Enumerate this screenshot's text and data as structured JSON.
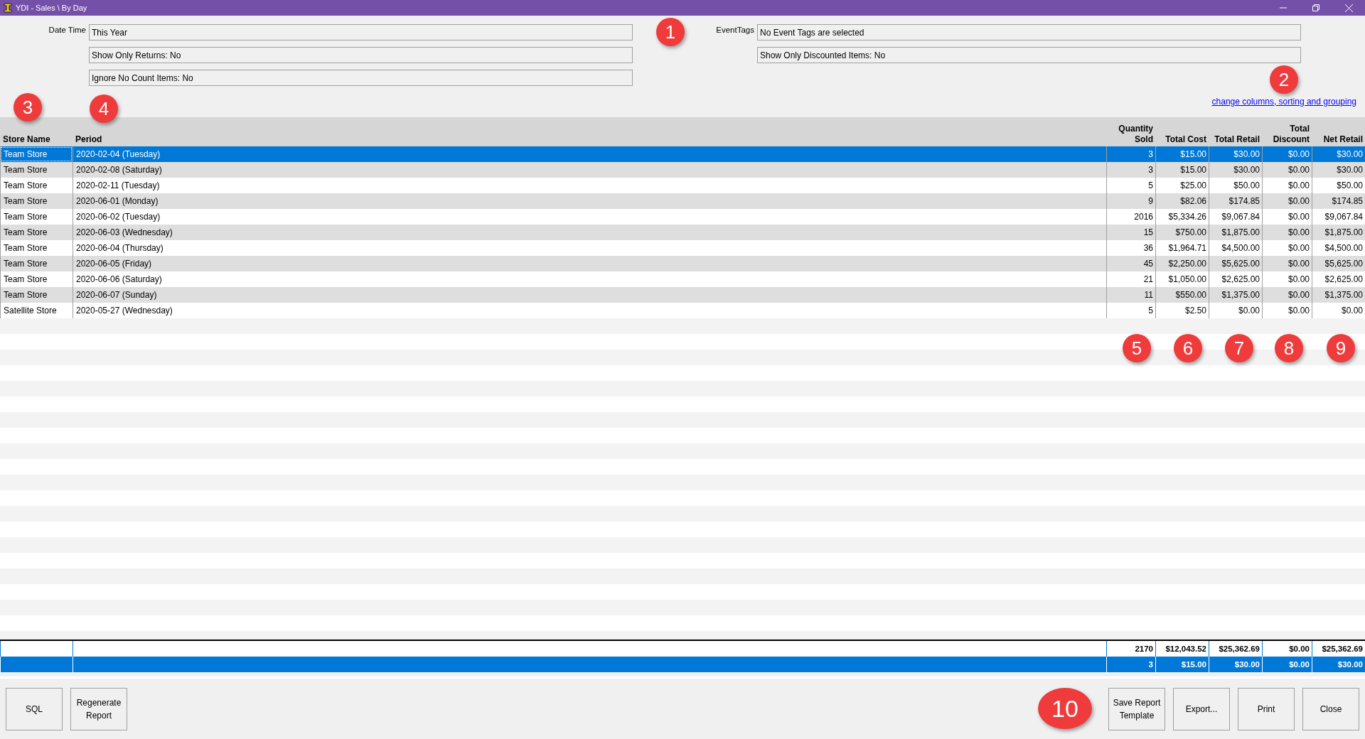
{
  "window": {
    "title": "YDI - Sales \\ By Day"
  },
  "filters_left": [
    {
      "label": "Date Time",
      "value": "This Year"
    },
    {
      "value": "Show Only Returns: No"
    },
    {
      "value": "Ignore No Count Items: No"
    }
  ],
  "filters_right": [
    {
      "label": "EventTags",
      "value": "No Event Tags are selected"
    },
    {
      "value": "Show Only Discounted Items: No"
    }
  ],
  "link": "change columns, sorting and grouping",
  "table": {
    "columns": [
      "Store Name",
      "Period",
      "Quantity Sold",
      "Total Cost",
      "Total Retail",
      "Total Discount",
      "Net Retail"
    ],
    "rows": [
      {
        "selected": true,
        "cells": [
          "Team Store",
          "2020-02-04 (Tuesday)",
          "3",
          "$15.00",
          "$30.00",
          "$0.00",
          "$30.00"
        ]
      },
      {
        "selected": false,
        "cells": [
          "Team Store",
          "2020-02-08 (Saturday)",
          "3",
          "$15.00",
          "$30.00",
          "$0.00",
          "$30.00"
        ]
      },
      {
        "selected": false,
        "cells": [
          "Team Store",
          "2020-02-11 (Tuesday)",
          "5",
          "$25.00",
          "$50.00",
          "$0.00",
          "$50.00"
        ]
      },
      {
        "selected": false,
        "cells": [
          "Team Store",
          "2020-06-01 (Monday)",
          "9",
          "$82.06",
          "$174.85",
          "$0.00",
          "$174.85"
        ]
      },
      {
        "selected": false,
        "cells": [
          "Team Store",
          "2020-06-02 (Tuesday)",
          "2016",
          "$5,334.26",
          "$9,067.84",
          "$0.00",
          "$9,067.84"
        ]
      },
      {
        "selected": false,
        "cells": [
          "Team Store",
          "2020-06-03 (Wednesday)",
          "15",
          "$750.00",
          "$1,875.00",
          "$0.00",
          "$1,875.00"
        ]
      },
      {
        "selected": false,
        "cells": [
          "Team Store",
          "2020-06-04 (Thursday)",
          "36",
          "$1,964.71",
          "$4,500.00",
          "$0.00",
          "$4,500.00"
        ]
      },
      {
        "selected": false,
        "cells": [
          "Team Store",
          "2020-06-05 (Friday)",
          "45",
          "$2,250.00",
          "$5,625.00",
          "$0.00",
          "$5,625.00"
        ]
      },
      {
        "selected": false,
        "cells": [
          "Team Store",
          "2020-06-06 (Saturday)",
          "21",
          "$1,050.00",
          "$2,625.00",
          "$0.00",
          "$2,625.00"
        ]
      },
      {
        "selected": false,
        "cells": [
          "Team Store",
          "2020-06-07 (Sunday)",
          "11",
          "$550.00",
          "$1,375.00",
          "$0.00",
          "$1,375.00"
        ]
      },
      {
        "selected": false,
        "cells": [
          "Satellite Store",
          "2020-05-27 (Wednesday)",
          "5",
          "$2.50",
          "$0.00",
          "$0.00",
          "$0.00"
        ]
      }
    ],
    "totals": [
      {
        "selected": false,
        "values": [
          "2170",
          "$12,043.52",
          "$25,362.69",
          "$0.00",
          "$25,362.69"
        ]
      },
      {
        "selected": true,
        "values": [
          "3",
          "$15.00",
          "$30.00",
          "$0.00",
          "$30.00"
        ]
      }
    ]
  },
  "buttons_left": [
    "SQL",
    "Regenerate Report"
  ],
  "buttons_right": [
    "Save Report Template",
    "Export...",
    "Print",
    "Close"
  ],
  "callouts": [
    "1",
    "2",
    "3",
    "4",
    "5",
    "6",
    "7",
    "8",
    "9",
    "10"
  ]
}
